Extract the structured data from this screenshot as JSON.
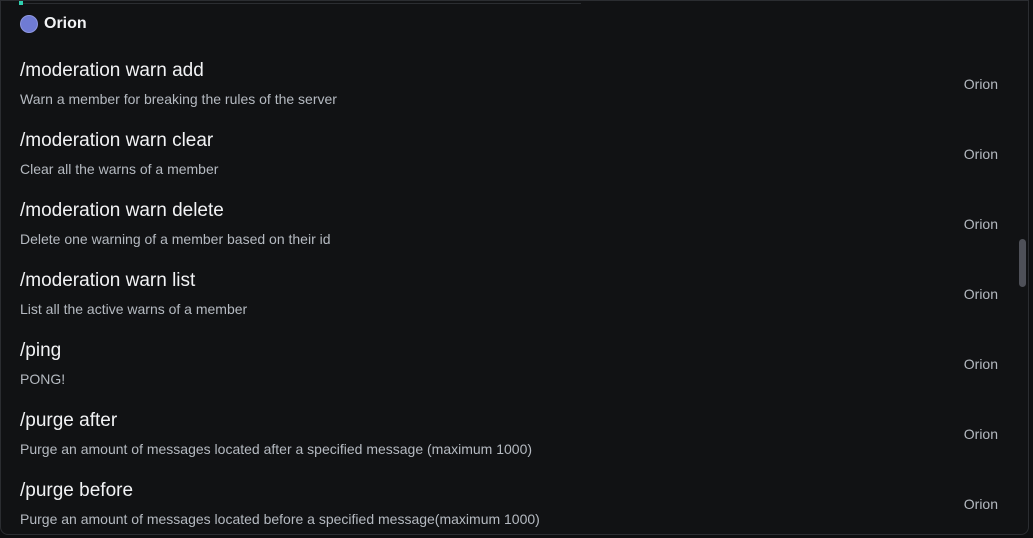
{
  "app": {
    "name": "Orion",
    "accent_color": "#6f7bd4"
  },
  "commands": [
    {
      "name": "/moderation warn add",
      "description": "Warn a member for breaking the rules of the server",
      "source": "Orion"
    },
    {
      "name": "/moderation warn clear",
      "description": "Clear all the warns of a member",
      "source": "Orion"
    },
    {
      "name": "/moderation warn delete",
      "description": "Delete one warning of a member based on their id",
      "source": "Orion"
    },
    {
      "name": "/moderation warn list",
      "description": "List all the active warns of a member",
      "source": "Orion"
    },
    {
      "name": "/ping",
      "description": "PONG!",
      "source": "Orion"
    },
    {
      "name": "/purge after",
      "description": "Purge an amount of messages located after a specified message (maximum 1000)",
      "source": "Orion"
    },
    {
      "name": "/purge before",
      "description": "Purge an amount of messages located before a specified message(maximum 1000)",
      "source": "Orion"
    }
  ]
}
